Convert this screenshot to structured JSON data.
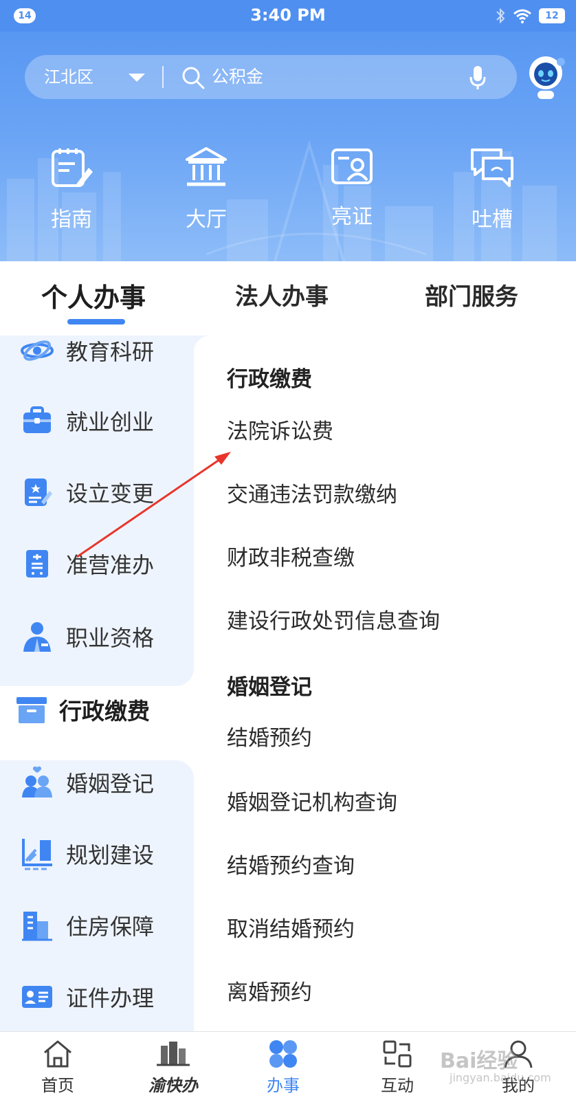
{
  "status_bar": {
    "notification_count": "14",
    "time": "3:40 PM",
    "battery": "12"
  },
  "header": {
    "region": "江北区",
    "search_text": "公积金",
    "quick_actions": [
      {
        "label": "指南",
        "icon": "guide-clipboard-icon"
      },
      {
        "label": "大厅",
        "icon": "hall-building-icon"
      },
      {
        "label": "亮证",
        "icon": "id-card-icon"
      },
      {
        "label": "吐槽",
        "icon": "feedback-chat-icon"
      }
    ]
  },
  "tabs": [
    "个人办事",
    "法人办事",
    "部门服务"
  ],
  "left_nav": {
    "items": [
      {
        "label": "教育科研",
        "icon": "atom-icon"
      },
      {
        "label": "就业创业",
        "icon": "briefcase-icon"
      },
      {
        "label": "设立变更",
        "icon": "certificate-edit-icon"
      },
      {
        "label": "准营准办",
        "icon": "license-icon"
      },
      {
        "label": "职业资格",
        "icon": "professional-person-icon"
      },
      {
        "label": "行政缴费",
        "icon": "archive-box-icon"
      },
      {
        "label": "婚姻登记",
        "icon": "couple-icon"
      },
      {
        "label": "规划建设",
        "icon": "planning-chart-icon"
      },
      {
        "label": "住房保障",
        "icon": "housing-building-icon"
      },
      {
        "label": "证件办理",
        "icon": "id-document-icon"
      }
    ],
    "selected": "行政缴费"
  },
  "right_content": {
    "sections": [
      {
        "title": "行政缴费",
        "items": [
          "法院诉讼费",
          "交通违法罚款缴纳",
          "财政非税查缴",
          "建设行政处罚信息查询"
        ]
      },
      {
        "title": "婚姻登记",
        "items": [
          "结婚预约",
          "婚姻登记机构查询",
          "结婚预约查询",
          "取消结婚预约",
          "离婚预约"
        ]
      }
    ]
  },
  "bottom_nav": [
    {
      "label": "首页",
      "icon": "home-icon"
    },
    {
      "label": "渝快办",
      "icon": "yukuaiban-logo-icon"
    },
    {
      "label": "办事",
      "icon": "four-petal-icon"
    },
    {
      "label": "互动",
      "icon": "interaction-swap-icon"
    },
    {
      "label": "我的",
      "icon": "user-icon"
    }
  ],
  "watermark": {
    "main": "Bai经验",
    "sub": "jingyan.baidu.com"
  },
  "colors": {
    "primary": "#3f86f2",
    "header_top": "#5897f2",
    "nav_bg": "#eef4fd",
    "annotation": "#e8352b"
  }
}
